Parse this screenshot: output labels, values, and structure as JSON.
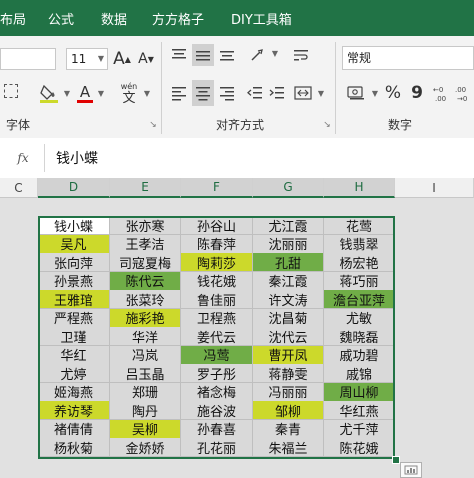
{
  "ribbon_tabs": [
    "布局",
    "公式",
    "数据",
    "方方格子",
    "DIY工具箱"
  ],
  "font": {
    "size": "11",
    "grow": "A",
    "shrink": "A",
    "bold": "B",
    "font_color_letter": "A",
    "phonetic_top": "wén",
    "phonetic_bottom": "文",
    "group_label": "字体"
  },
  "alignment": {
    "group_label": "对齐方式"
  },
  "number": {
    "format": "常规",
    "percent": "%",
    "comma": "9",
    "group_label": "数字"
  },
  "formula_bar": {
    "fx": "fx",
    "value": "钱小蝶"
  },
  "columns": [
    {
      "label": "C",
      "selected": false
    },
    {
      "label": "D",
      "selected": true
    },
    {
      "label": "E",
      "selected": true
    },
    {
      "label": "F",
      "selected": true
    },
    {
      "label": "G",
      "selected": true
    },
    {
      "label": "H",
      "selected": true
    },
    {
      "label": "I",
      "selected": false
    }
  ],
  "colors": {
    "header_green": "#217346",
    "cell_grey": "#d9d9d9",
    "cell_green": "#70ad47",
    "cell_yellow": "#ccd92b",
    "cell_white": "#ffffff"
  },
  "rows": [
    [
      {
        "t": "钱小蝶",
        "c": "w"
      },
      {
        "t": "张亦寒",
        "c": "g"
      },
      {
        "t": "孙谷山",
        "c": "g"
      },
      {
        "t": "尤江霞",
        "c": "g"
      },
      {
        "t": "花莺",
        "c": "g"
      }
    ],
    [
      {
        "t": "吴凡",
        "c": "y"
      },
      {
        "t": "王孝洁",
        "c": "g"
      },
      {
        "t": "陈春萍",
        "c": "g"
      },
      {
        "t": "沈丽丽",
        "c": "g"
      },
      {
        "t": "钱翡翠",
        "c": "g"
      }
    ],
    [
      {
        "t": "张向萍",
        "c": "g"
      },
      {
        "t": "司寇夏梅",
        "c": "g"
      },
      {
        "t": "陶莉莎",
        "c": "y"
      },
      {
        "t": "孔甜",
        "c": "G"
      },
      {
        "t": "杨宏艳",
        "c": "g"
      }
    ],
    [
      {
        "t": "孙景燕",
        "c": "g"
      },
      {
        "t": "陈代云",
        "c": "G"
      },
      {
        "t": "钱花娥",
        "c": "g"
      },
      {
        "t": "秦江霞",
        "c": "g"
      },
      {
        "t": "蒋巧丽",
        "c": "g"
      }
    ],
    [
      {
        "t": "王雅琯",
        "c": "y"
      },
      {
        "t": "张菜玲",
        "c": "g"
      },
      {
        "t": "鲁佳丽",
        "c": "g"
      },
      {
        "t": "许文涛",
        "c": "g"
      },
      {
        "t": "澹台亚萍",
        "c": "G"
      }
    ],
    [
      {
        "t": "严程燕",
        "c": "g"
      },
      {
        "t": "施彩艳",
        "c": "y"
      },
      {
        "t": "卫程燕",
        "c": "g"
      },
      {
        "t": "沈昌菊",
        "c": "g"
      },
      {
        "t": "尤敏",
        "c": "g"
      }
    ],
    [
      {
        "t": "卫瑾",
        "c": "g"
      },
      {
        "t": "华洋",
        "c": "g"
      },
      {
        "t": "姜代云",
        "c": "g"
      },
      {
        "t": "沈代云",
        "c": "g"
      },
      {
        "t": "魏晓磊",
        "c": "g"
      }
    ],
    [
      {
        "t": "华红",
        "c": "g"
      },
      {
        "t": "冯岚",
        "c": "g"
      },
      {
        "t": "冯莺",
        "c": "G"
      },
      {
        "t": "曹开凤",
        "c": "y"
      },
      {
        "t": "戚功碧",
        "c": "g"
      }
    ],
    [
      {
        "t": "尤婷",
        "c": "g"
      },
      {
        "t": "吕玉晶",
        "c": "g"
      },
      {
        "t": "罗子彤",
        "c": "g"
      },
      {
        "t": "蒋静雯",
        "c": "g"
      },
      {
        "t": "戚锦",
        "c": "g"
      }
    ],
    [
      {
        "t": "姬海燕",
        "c": "g"
      },
      {
        "t": "郑珊",
        "c": "g"
      },
      {
        "t": "褚念梅",
        "c": "g"
      },
      {
        "t": "冯丽丽",
        "c": "g"
      },
      {
        "t": "周山柳",
        "c": "G"
      }
    ],
    [
      {
        "t": "养访琴",
        "c": "y"
      },
      {
        "t": "陶丹",
        "c": "g"
      },
      {
        "t": "施谷波",
        "c": "g"
      },
      {
        "t": "邹柳",
        "c": "y"
      },
      {
        "t": "华红燕",
        "c": "g"
      }
    ],
    [
      {
        "t": "褚倩倩",
        "c": "g"
      },
      {
        "t": "吴柳",
        "c": "y"
      },
      {
        "t": "孙春喜",
        "c": "g"
      },
      {
        "t": "秦青",
        "c": "g"
      },
      {
        "t": "尤千萍",
        "c": "g"
      }
    ],
    [
      {
        "t": "杨秋菊",
        "c": "g"
      },
      {
        "t": "金娇娇",
        "c": "g"
      },
      {
        "t": "孔花丽",
        "c": "g"
      },
      {
        "t": "朱福兰",
        "c": "g"
      },
      {
        "t": "陈花娥",
        "c": "g"
      }
    ]
  ]
}
